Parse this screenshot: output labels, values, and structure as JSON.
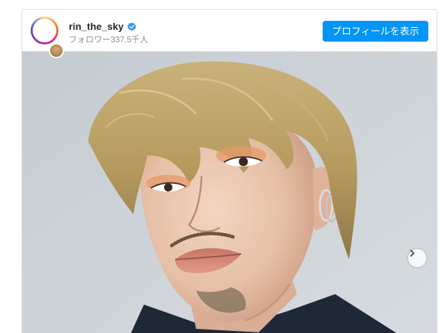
{
  "post": {
    "username": "rin_the_sky",
    "followers": "フォロワー337.5千人",
    "view_profile_label": "プロフィールを表示"
  },
  "colors": {
    "button_blue": "#0095f6",
    "verified_blue": "#3897f0",
    "username_text": "#262626",
    "muted_text": "#8e8e8e"
  },
  "icons": {
    "verified": "verified-badge-icon",
    "next": "chevron-right-icon"
  }
}
